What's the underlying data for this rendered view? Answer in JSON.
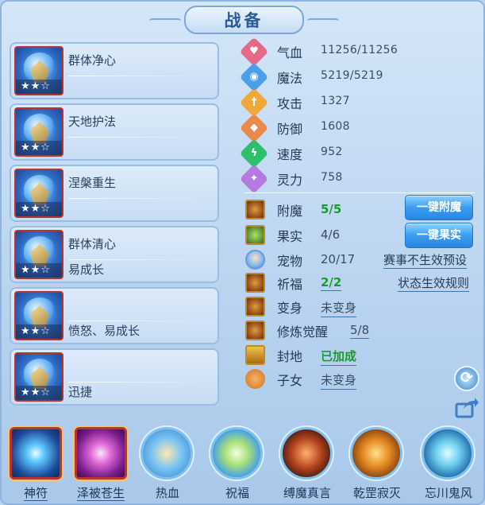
{
  "title": "战备",
  "skills": [
    {
      "name": "群体净心",
      "tag": "",
      "stars": "★★☆"
    },
    {
      "name": "天地护法",
      "tag": "",
      "stars": "★★☆"
    },
    {
      "name": "涅槃重生",
      "tag": "",
      "stars": "★★☆"
    },
    {
      "name": "群体清心",
      "tag": "易成长",
      "stars": "★★☆"
    },
    {
      "name": "",
      "tag": "愤怒、易成长",
      "stars": "★★☆"
    },
    {
      "name": "",
      "tag": "迅捷",
      "stars": "★★☆"
    }
  ],
  "attributes": [
    {
      "icon": "heart-icon",
      "label": "气血",
      "value": "11256/11256",
      "color": "#e46a8a"
    },
    {
      "icon": "magic-icon",
      "label": "魔法",
      "value": "5219/5219",
      "color": "#4aa0e8"
    },
    {
      "icon": "sword-icon",
      "label": "攻击",
      "value": "1327",
      "color": "#f0a83a"
    },
    {
      "icon": "shield-icon",
      "label": "防御",
      "value": "1608",
      "color": "#e98a4a"
    },
    {
      "icon": "speed-icon",
      "label": "速度",
      "value": "952",
      "color": "#2fbf6a"
    },
    {
      "icon": "spirit-icon",
      "label": "灵力",
      "value": "758",
      "color": "#b679e0"
    }
  ],
  "status": {
    "enchant": {
      "label": "附魔",
      "value": "5/5",
      "button": "一键附魔"
    },
    "fruit": {
      "label": "果实",
      "value": "4/6",
      "button": "一键果实"
    },
    "pet": {
      "label": "宠物",
      "value": "20/17",
      "link": "赛事不生效预设"
    },
    "blessing": {
      "label": "祈福",
      "value": "2/2",
      "link": "状态生效规则"
    },
    "transform": {
      "label": "变身",
      "value": "未变身"
    },
    "awaken": {
      "label": "修炼觉醒",
      "value": "5/8"
    },
    "seal": {
      "label": "封地",
      "value": "已加成"
    },
    "children": {
      "label": "子女",
      "value": "未变身"
    }
  },
  "bottom": [
    {
      "label": "神符",
      "icon": "rune-icon"
    },
    {
      "label": "泽被苍生",
      "icon": "palm-icon"
    },
    {
      "label": "热血",
      "icon": "fire-spirit-icon"
    },
    {
      "label": "祝福",
      "icon": "lotus-icon"
    },
    {
      "label": "缚魔真言",
      "icon": "demon-icon"
    },
    {
      "label": "乾罡寂灭",
      "icon": "fist-icon"
    },
    {
      "label": "忘川鬼风",
      "icon": "wind-icon"
    }
  ]
}
